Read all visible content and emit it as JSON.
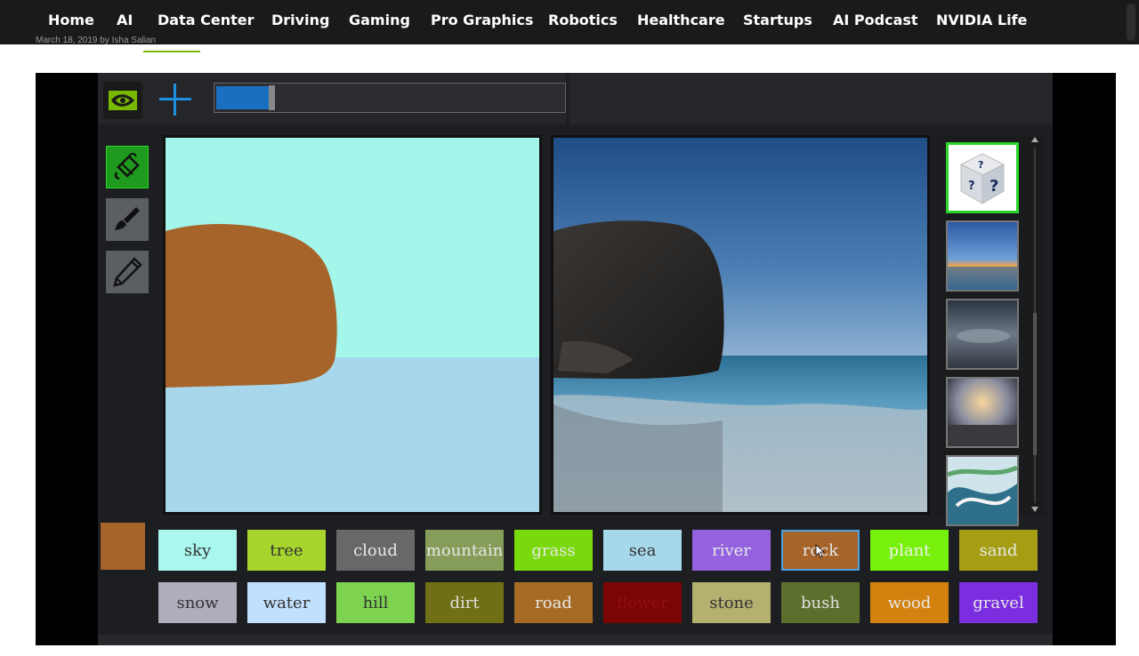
{
  "nav": {
    "items": [
      "Home",
      "AI",
      "Data Center",
      "Driving",
      "Gaming",
      "Pro Graphics",
      "Robotics",
      "Healthcare",
      "Startups",
      "AI Podcast",
      "NVIDIA Life"
    ]
  },
  "byline": {
    "text": "March 18, 2019 by Isha Salian"
  },
  "app": {
    "logo_icon": "nvidia-eye-logo-icon",
    "add_icon": "plus-icon",
    "progress_fraction": 0.15,
    "tools": [
      {
        "name": "paint-bucket-icon",
        "active": true
      },
      {
        "name": "brush-icon",
        "active": false
      },
      {
        "name": "pencil-icon",
        "active": false
      }
    ],
    "current_color": "#a6642a",
    "thumbnails": [
      {
        "name": "random-style-dice-icon",
        "selected": true
      },
      {
        "name": "style-sunset-sea",
        "selected": false
      },
      {
        "name": "style-cloudy-sky",
        "selected": false
      },
      {
        "name": "style-golden-clouds",
        "selected": false
      },
      {
        "name": "style-painting",
        "selected": false
      }
    ],
    "labels_row1": [
      {
        "text": "sky",
        "color": "#aaf7ef",
        "fg": "#333333"
      },
      {
        "text": "tree",
        "color": "#a7d52e",
        "fg": "#333333"
      },
      {
        "text": "cloud",
        "color": "#686868",
        "fg": "#e8e8e8"
      },
      {
        "text": "mountain",
        "color": "#859d59",
        "fg": "#e8e8e8"
      },
      {
        "text": "grass",
        "color": "#7ad90c",
        "fg": "#e8e8e8"
      },
      {
        "text": "sea",
        "color": "#a6d7ea",
        "fg": "#333333"
      },
      {
        "text": "river",
        "color": "#9462de",
        "fg": "#e8e8e8"
      },
      {
        "text": "rock",
        "color": "#a6642a",
        "fg": "#e8e8e8",
        "selected": true
      },
      {
        "text": "plant",
        "color": "#77f10b",
        "fg": "#f0f0f0"
      },
      {
        "text": "sand",
        "color": "#a59e14",
        "fg": "#e8e8e8"
      }
    ],
    "labels_row2": [
      {
        "text": "snow",
        "color": "#aeadbb",
        "fg": "#333333"
      },
      {
        "text": "water",
        "color": "#c1e0fe",
        "fg": "#333333"
      },
      {
        "text": "hill",
        "color": "#7dd250",
        "fg": "#333333"
      },
      {
        "text": "dirt",
        "color": "#6f6f15",
        "fg": "#e0e0e0"
      },
      {
        "text": "road",
        "color": "#a76b25",
        "fg": "#e8e8e8"
      },
      {
        "text": "flower",
        "color": "#7b0505",
        "fg": "#8c1010"
      },
      {
        "text": "stone",
        "color": "#b3b070",
        "fg": "#333333"
      },
      {
        "text": "bush",
        "color": "#5d6f2d",
        "fg": "#e0e0e0"
      },
      {
        "text": "wood",
        "color": "#d3820f",
        "fg": "#e8e8e8"
      },
      {
        "text": "gravel",
        "color": "#7b2ee0",
        "fg": "#e8e8e8"
      }
    ]
  }
}
